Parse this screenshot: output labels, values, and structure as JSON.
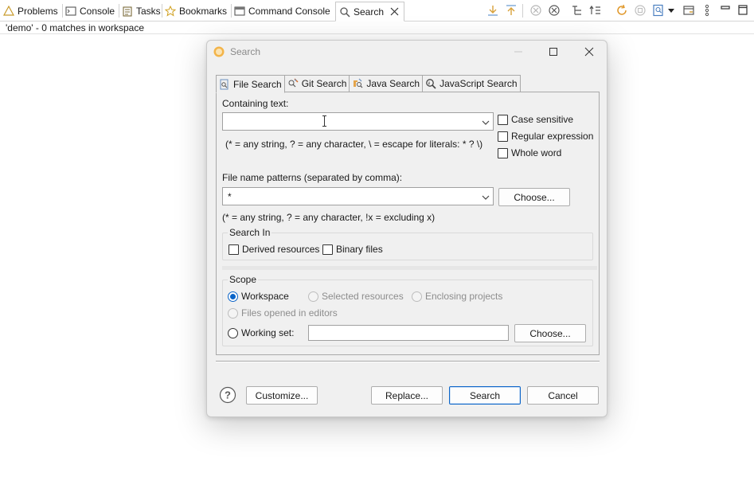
{
  "view_tabs": [
    {
      "label": "Problems",
      "icon": "problems-icon"
    },
    {
      "label": "Console",
      "icon": "console-icon"
    },
    {
      "label": "Tasks",
      "icon": "tasks-icon"
    },
    {
      "label": "Bookmarks",
      "icon": "bookmark-icon"
    },
    {
      "label": "Command Console",
      "icon": "command-console-icon"
    },
    {
      "label": "Search",
      "icon": "search-icon",
      "active": true
    }
  ],
  "status_line": "'demo' - 0 matches in workspace",
  "dialog": {
    "title": "Search",
    "tabs": [
      {
        "label": "File Search",
        "icon": "file-search-icon",
        "active": true
      },
      {
        "label": "Git Search",
        "icon": "git-search-icon"
      },
      {
        "label": "Java Search",
        "icon": "java-search-icon"
      },
      {
        "label": "JavaScript Search",
        "icon": "javascript-search-icon"
      }
    ],
    "containing_text": {
      "label": "Containing text:",
      "value": "",
      "hint": "(* = any string, ? = any character, \\ = escape for literals: * ? \\)"
    },
    "options": {
      "case_sensitive": {
        "label": "Case sensitive",
        "checked": false
      },
      "regular_expression": {
        "label": "Regular expression",
        "checked": false
      },
      "whole_word": {
        "label": "Whole word",
        "checked": false
      }
    },
    "file_patterns": {
      "label": "File name patterns (separated by comma):",
      "value": "*",
      "hint": "(* = any string, ? = any character, !x = excluding x)",
      "choose_label": "Choose..."
    },
    "search_in": {
      "title": "Search In",
      "derived": {
        "label": "Derived resources",
        "checked": false
      },
      "binary": {
        "label": "Binary files",
        "checked": false
      }
    },
    "scope": {
      "title": "Scope",
      "workspace": {
        "label": "Workspace",
        "selected": true
      },
      "selected_resources": {
        "label": "Selected resources",
        "enabled": false
      },
      "enclosing_projects": {
        "label": "Enclosing projects",
        "enabled": false
      },
      "files_opened": {
        "label": "Files opened in editors",
        "enabled": false
      },
      "working_set": {
        "label": "Working set:",
        "value": "",
        "choose_label": "Choose..."
      }
    },
    "buttons": {
      "customize": "Customize...",
      "replace": "Replace...",
      "search": "Search",
      "cancel": "Cancel"
    }
  },
  "colors": {
    "accent": "#0a64c8",
    "dialog_bg": "#f0f0f0",
    "disabled_text": "#8d8d8d"
  }
}
